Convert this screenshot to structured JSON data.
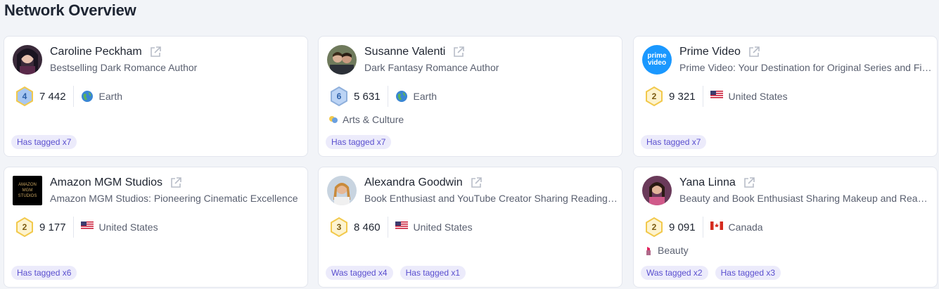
{
  "page": {
    "title": "Network Overview"
  },
  "cards": [
    {
      "name": "Caroline Peckham",
      "description": "Bestselling Dark Romance Author",
      "level": "4",
      "followers": "7 442",
      "location": "Earth",
      "location_icon": "globe-icon",
      "category": "",
      "tags": [
        "Has tagged x7"
      ]
    },
    {
      "name": "Susanne Valenti",
      "description": "Dark Fantasy Romance Author",
      "level": "6",
      "followers": "5 631",
      "location": "Earth",
      "location_icon": "globe-icon",
      "category": "Arts & Culture",
      "tags": [
        "Has tagged x7"
      ]
    },
    {
      "name": "Prime Video",
      "description": "Prime Video: Your Destination for Original Series and Films",
      "level": "2",
      "followers": "9 321",
      "location": "United States",
      "location_icon": "us-flag-icon",
      "category": "",
      "tags": [
        "Has tagged x7"
      ]
    },
    {
      "name": "Amazon MGM Studios",
      "description": "Amazon MGM Studios: Pioneering Cinematic Excellence",
      "level": "2",
      "followers": "9 177",
      "location": "United States",
      "location_icon": "us-flag-icon",
      "category": "",
      "tags": [
        "Has tagged x6"
      ]
    },
    {
      "name": "Alexandra Goodwin",
      "description": "Book Enthusiast and YouTube Creator Sharing Reading Adventures",
      "level": "3",
      "followers": "8 460",
      "location": "United States",
      "location_icon": "us-flag-icon",
      "category": "",
      "tags": [
        "Was tagged x4",
        "Has tagged x1"
      ]
    },
    {
      "name": "Yana Linna",
      "description": "Beauty and Book Enthusiast Sharing Makeup and Reading",
      "level": "2",
      "followers": "9 091",
      "location": "Canada",
      "location_icon": "canada-flag-icon",
      "category": "Beauty",
      "tags": [
        "Was tagged x2",
        "Has tagged x3"
      ]
    }
  ],
  "avatars": {
    "prime_video_logo_line1": "prime",
    "prime_video_logo_line2": "video",
    "amazon_mgm_logo_line1": "AMAZON",
    "amazon_mgm_logo_line2": "MGM",
    "amazon_mgm_logo_line3": "STUDIOS"
  },
  "colors": {
    "accent": "#5a4fcf",
    "tag_bg": "#ecebfb",
    "gold": "#f2c94c",
    "blue_badge": "#a7c7f2"
  }
}
